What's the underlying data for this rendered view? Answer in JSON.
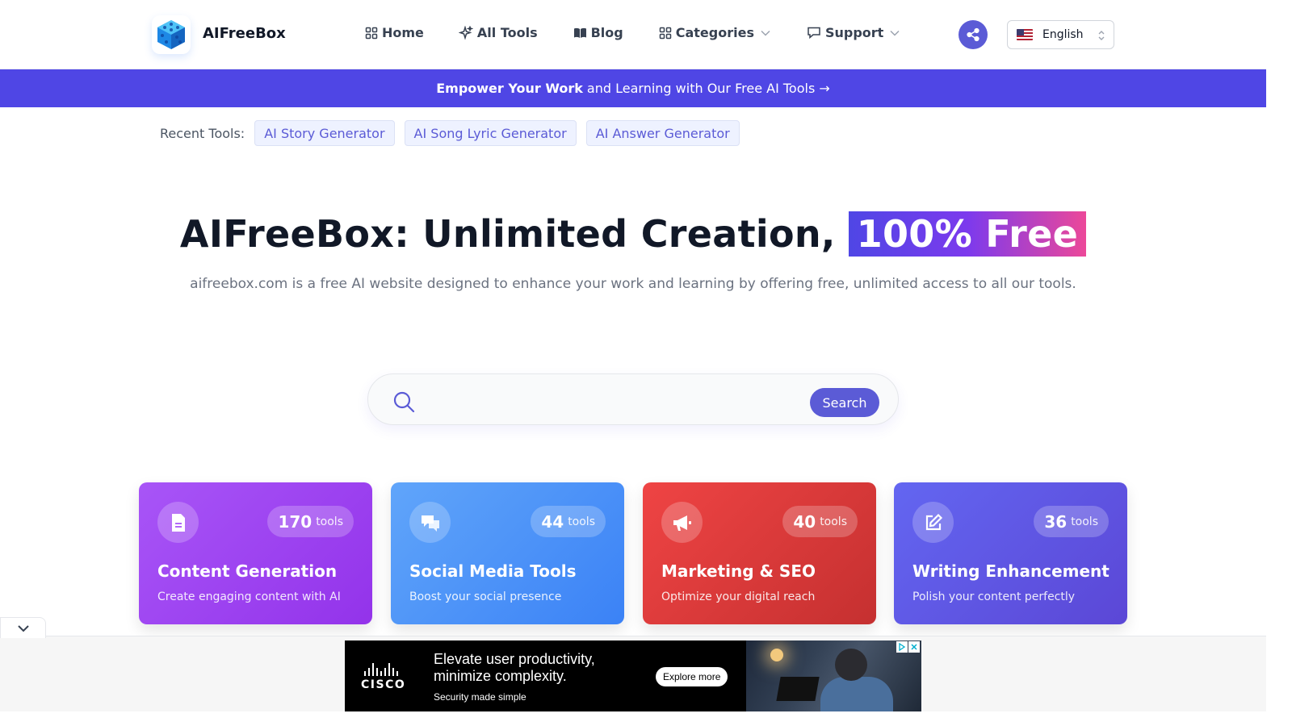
{
  "header": {
    "brand": "AIFreeBox",
    "nav": [
      {
        "label": "Home"
      },
      {
        "label": "All Tools"
      },
      {
        "label": "Blog"
      },
      {
        "label": "Categories"
      },
      {
        "label": "Support"
      }
    ],
    "language": "English"
  },
  "banner": {
    "bold": "Empower Your Work",
    "rest": "and Learning with Our Free AI Tools →"
  },
  "recent": {
    "label": "Recent Tools:",
    "tools": [
      "AI Story Generator",
      "AI Song Lyric Generator",
      "AI Answer Generator"
    ]
  },
  "hero": {
    "title": "AIFreeBox: Unlimited Creation,",
    "highlight": "100% Free",
    "subtitle": "aifreebox.com is a free AI website designed to enhance your work and learning by offering free, unlimited access to all our tools."
  },
  "search": {
    "value": "",
    "button": "Search"
  },
  "categories": [
    {
      "count": "170",
      "unit": "tools",
      "title": "Content Generation",
      "desc": "Create engaging content with AI",
      "icon": "document-icon"
    },
    {
      "count": "44",
      "unit": "tools",
      "title": "Social Media Tools",
      "desc": "Boost your social presence",
      "icon": "chat-bubbles-icon"
    },
    {
      "count": "40",
      "unit": "tools",
      "title": "Marketing & SEO",
      "desc": "Optimize your digital reach",
      "icon": "megaphone-icon"
    },
    {
      "count": "36",
      "unit": "tools",
      "title": "Writing Enhancement",
      "desc": "Polish your content perfectly",
      "icon": "edit-icon"
    }
  ],
  "ad": {
    "brand": "CISCO",
    "headline_1": "Elevate user productivity,",
    "headline_2": "minimize complexity.",
    "tagline": "Security made simple",
    "cta": "Explore more"
  },
  "colors": {
    "accent": "#4f46e5",
    "content_generation": "#a855f7",
    "social_media": "#3b82f6",
    "marketing": "#ef4444",
    "writing": "#6366f1"
  }
}
